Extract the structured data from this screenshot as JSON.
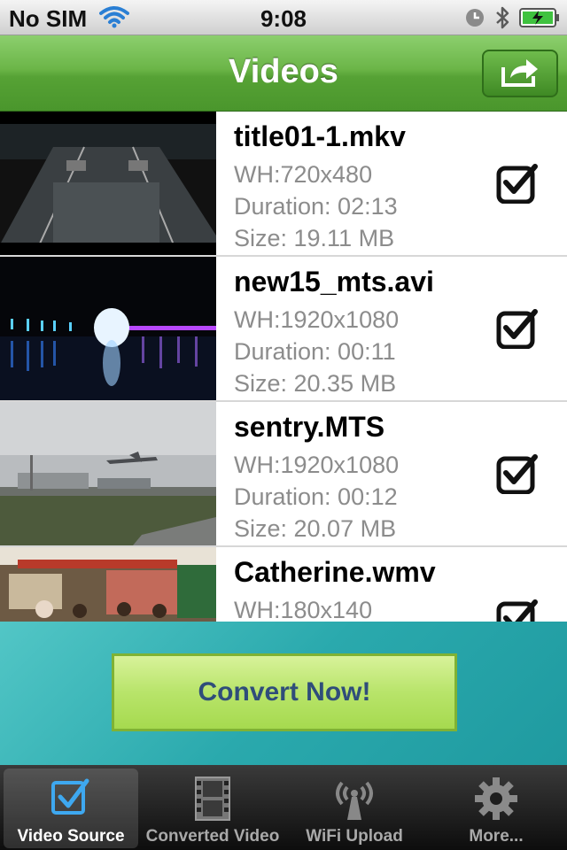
{
  "status_bar": {
    "carrier": "No SIM",
    "time": "9:08"
  },
  "nav": {
    "title": "Videos",
    "share_icon": "share-icon"
  },
  "videos": [
    {
      "name": "title01-1.mkv",
      "wh": "WH:720x480",
      "duration": "Duration: 02:13",
      "size": "Size: 19.11 MB",
      "checked": true
    },
    {
      "name": "new15_mts.avi",
      "wh": "WH:1920x1080",
      "duration": "Duration: 00:11",
      "size": "Size: 20.35 MB",
      "checked": true
    },
    {
      "name": "sentry.MTS",
      "wh": "WH:1920x1080",
      "duration": "Duration: 00:12",
      "size": "Size: 20.07 MB",
      "checked": true
    },
    {
      "name": "Catherine.wmv",
      "wh": "WH:180x140",
      "duration": "",
      "size": "",
      "checked": true
    }
  ],
  "convert_button": {
    "label": "Convert Now!"
  },
  "tabs": [
    {
      "label": "Video Source",
      "icon": "checkbox-icon",
      "active": true
    },
    {
      "label": "Converted Video",
      "icon": "film-icon",
      "active": false
    },
    {
      "label": "WiFi Upload",
      "icon": "wifi-antenna-icon",
      "active": false
    },
    {
      "label": "More...",
      "icon": "gear-icon",
      "active": false
    }
  ],
  "colors": {
    "nav_green": "#5aa83a",
    "convert_bg": "#2aa9ad",
    "convert_btn": "#b8e46a",
    "convert_text": "#2f4d7a"
  }
}
